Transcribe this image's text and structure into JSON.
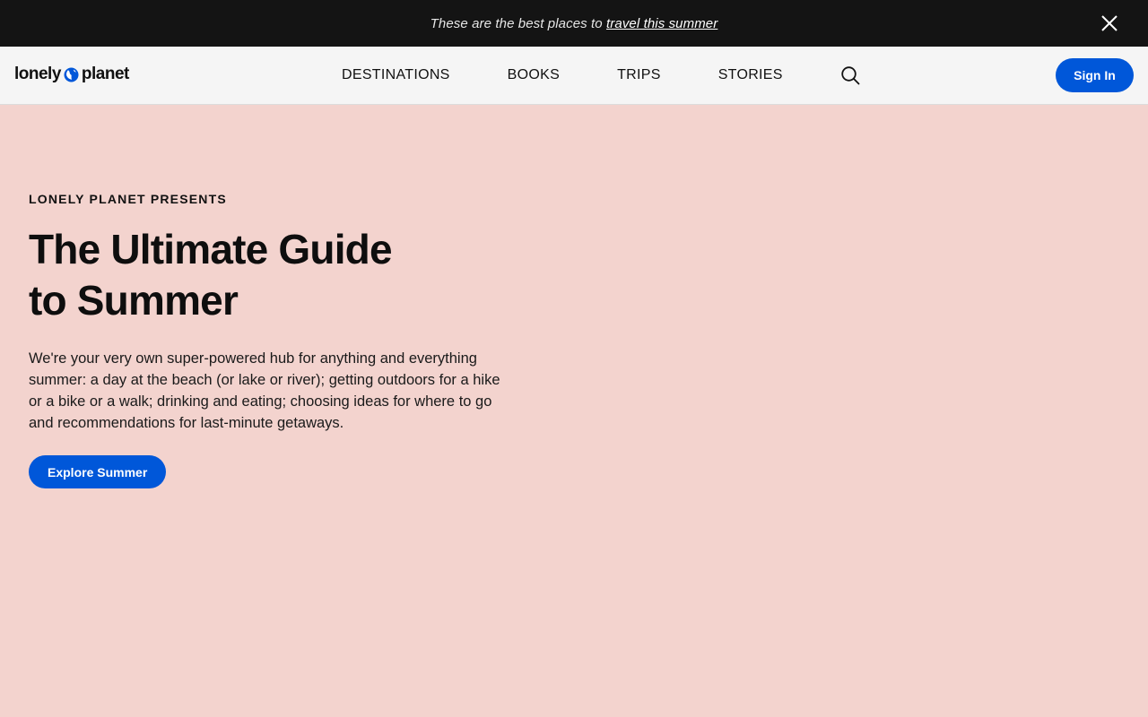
{
  "promo": {
    "text": "These are the best places to ",
    "link_label": "travel this summer",
    "close_icon": "close-icon"
  },
  "header": {
    "logo_left": "lonely",
    "logo_right": "planet",
    "logo_icon": "globe-icon",
    "nav": {
      "destinations": "DESTINATIONS",
      "books": "BOOKS",
      "trips": "TRIPS",
      "stories": "STORIES"
    },
    "search_icon": "search-icon",
    "sign_in_label": "Sign In"
  },
  "hero": {
    "eyebrow": "LONELY PLANET PRESENTS",
    "title_line1": "The Ultimate Guide",
    "title_line2": "to Summer",
    "body": "We're your very own super-powered hub for anything and everything summer: a day at the beach (or lake or river); getting outdoors for a hike or a bike or a walk; drinking and eating; choosing ideas for where to go and recommendations for last-minute getaways.",
    "cta_label": "Explore Summer"
  },
  "colors": {
    "accent": "#0057d9",
    "promo_bg": "#141414",
    "header_bg": "#f5f5f5",
    "page_bg": "#f3d3ce"
  }
}
